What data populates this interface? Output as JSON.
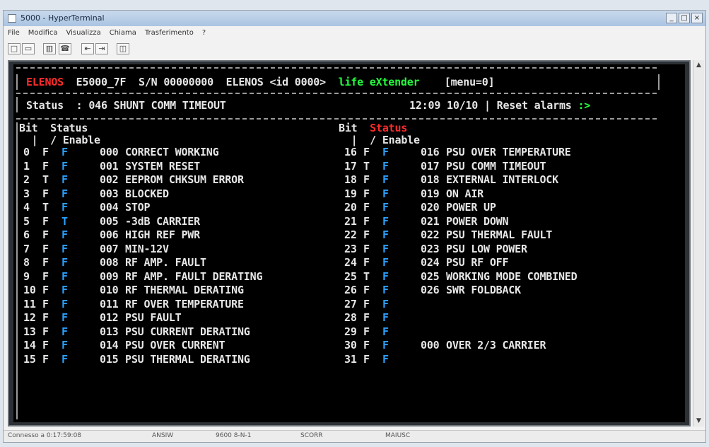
{
  "window": {
    "title": "5000 - HyperTerminal"
  },
  "menu": [
    "File",
    "Modifica",
    "Visualizza",
    "Chiama",
    "Trasferimento",
    "?"
  ],
  "toolbar": [
    {
      "icon": "new-icon",
      "glyph": "□"
    },
    {
      "icon": "open-icon",
      "glyph": "▭"
    },
    {
      "icon": "disconnect-icon",
      "glyph": "▥"
    },
    {
      "icon": "phone-icon",
      "glyph": "☎"
    },
    {
      "icon": "send-icon",
      "glyph": "⇤"
    },
    {
      "icon": "receive-icon",
      "glyph": "⇥"
    },
    {
      "icon": "properties-icon",
      "glyph": "◫"
    }
  ],
  "terminal": {
    "header": {
      "brand": "ELENOS",
      "model": "E5000_7F",
      "serial": "S/N 00000000",
      "device": "ELENOS <id 0000>",
      "tagline": "life eXtender",
      "menu": "[menu=0]"
    },
    "status_label": "Status  :",
    "status_value": "046 SHUNT COMM TIMEOUT",
    "datetime": "12:09 10/10",
    "reset": "Reset alarms",
    "reset_arrow": ":>",
    "columns": {
      "bit": "Bit",
      "status": "Status",
      "enable": "Enable"
    },
    "left": [
      {
        "bit": "0",
        "status": "F",
        "enable": "F",
        "code": "000",
        "text": "CORRECT WORKING"
      },
      {
        "bit": "1",
        "status": "F",
        "enable": "F",
        "code": "001",
        "text": "SYSTEM RESET"
      },
      {
        "bit": "2",
        "status": "T",
        "enable": "F",
        "code": "002",
        "text": "EEPROM CHKSUM ERROR"
      },
      {
        "bit": "3",
        "status": "F",
        "enable": "F",
        "code": "003",
        "text": "BLOCKED"
      },
      {
        "bit": "4",
        "status": "T",
        "enable": "F",
        "code": "004",
        "text": "STOP"
      },
      {
        "bit": "5",
        "status": "F",
        "enable": "T",
        "code": "005",
        "text": "-3dB CARRIER"
      },
      {
        "bit": "6",
        "status": "F",
        "enable": "F",
        "code": "006",
        "text": "HIGH REF PWR"
      },
      {
        "bit": "7",
        "status": "F",
        "enable": "F",
        "code": "007",
        "text": "MIN-12V"
      },
      {
        "bit": "8",
        "status": "F",
        "enable": "F",
        "code": "008",
        "text": "RF AMP. FAULT"
      },
      {
        "bit": "9",
        "status": "F",
        "enable": "F",
        "code": "009",
        "text": "RF AMP. FAULT DERATING"
      },
      {
        "bit": "10",
        "status": "F",
        "enable": "F",
        "code": "010",
        "text": "RF THERMAL DERATING"
      },
      {
        "bit": "11",
        "status": "F",
        "enable": "F",
        "code": "011",
        "text": "RF OVER TEMPERATURE"
      },
      {
        "bit": "12",
        "status": "F",
        "enable": "F",
        "code": "012",
        "text": "PSU FAULT"
      },
      {
        "bit": "13",
        "status": "F",
        "enable": "F",
        "code": "013",
        "text": "PSU CURRENT DERATING"
      },
      {
        "bit": "14",
        "status": "F",
        "enable": "F",
        "code": "014",
        "text": "PSU OVER CURRENT"
      },
      {
        "bit": "15",
        "status": "F",
        "enable": "F",
        "code": "015",
        "text": "PSU THERMAL DERATING"
      }
    ],
    "right": [
      {
        "bit": "16",
        "status": "F",
        "enable": "F",
        "code": "016",
        "text": "PSU OVER TEMPERATURE"
      },
      {
        "bit": "17",
        "status": "T",
        "enable": "F",
        "code": "017",
        "text": "PSU COMM TIMEOUT"
      },
      {
        "bit": "18",
        "status": "F",
        "enable": "F",
        "code": "018",
        "text": "EXTERNAL INTERLOCK"
      },
      {
        "bit": "19",
        "status": "F",
        "enable": "F",
        "code": "019",
        "text": "ON AIR"
      },
      {
        "bit": "20",
        "status": "F",
        "enable": "F",
        "code": "020",
        "text": "POWER UP"
      },
      {
        "bit": "21",
        "status": "F",
        "enable": "F",
        "code": "021",
        "text": "POWER DOWN"
      },
      {
        "bit": "22",
        "status": "F",
        "enable": "F",
        "code": "022",
        "text": "PSU THERMAL FAULT"
      },
      {
        "bit": "23",
        "status": "F",
        "enable": "F",
        "code": "023",
        "text": "PSU LOW POWER"
      },
      {
        "bit": "24",
        "status": "F",
        "enable": "F",
        "code": "024",
        "text": "PSU RF OFF"
      },
      {
        "bit": "25",
        "status": "T",
        "enable": "F",
        "code": "025",
        "text": "WORKING MODE COMBINED"
      },
      {
        "bit": "26",
        "status": "F",
        "enable": "F",
        "code": "026",
        "text": "SWR FOLDBACK"
      },
      {
        "bit": "27",
        "status": "F",
        "enable": "F",
        "code": "",
        "text": ""
      },
      {
        "bit": "28",
        "status": "F",
        "enable": "F",
        "code": "",
        "text": ""
      },
      {
        "bit": "29",
        "status": "F",
        "enable": "F",
        "code": "",
        "text": ""
      },
      {
        "bit": "30",
        "status": "F",
        "enable": "F",
        "code": "000",
        "text": "OVER 2/3 CARRIER"
      },
      {
        "bit": "31",
        "status": "F",
        "enable": "F",
        "code": "",
        "text": ""
      }
    ]
  },
  "statusbar": [
    "Connesso a 0:17:59:08",
    "ANSIW",
    "9600 8-N-1",
    "SCORR",
    "MAIUSC"
  ]
}
